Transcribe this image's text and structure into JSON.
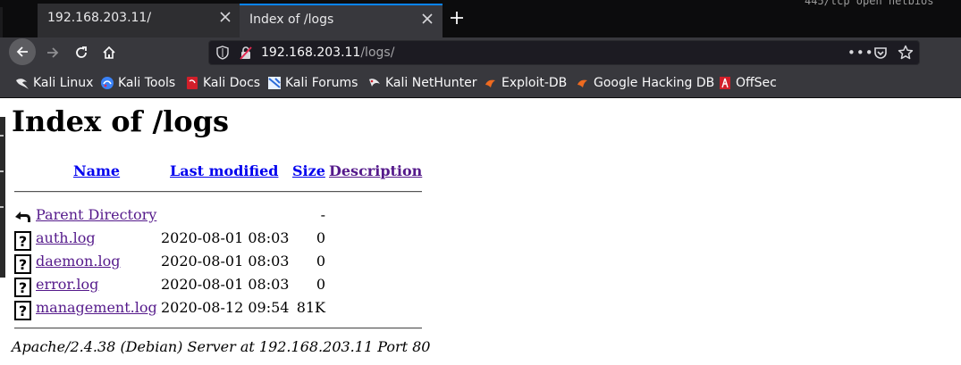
{
  "tabs": [
    {
      "title": "192.168.203.11/"
    },
    {
      "title": "Index of /logs"
    }
  ],
  "terminal_fragment": "445/tcp  open  netbios",
  "url": {
    "host": "192.168.203.11",
    "path": "/logs/"
  },
  "bookmarks": [
    {
      "label": "Kali Linux",
      "icon": "kali-dragon-icon"
    },
    {
      "label": "Kali Tools",
      "icon": "kali-tools-icon"
    },
    {
      "label": "Kali Docs",
      "icon": "kali-docs-icon"
    },
    {
      "label": "Kali Forums",
      "icon": "kali-forums-icon"
    },
    {
      "label": "Kali NetHunter",
      "icon": "nethunter-icon"
    },
    {
      "label": "Exploit-DB",
      "icon": "exploit-db-icon"
    },
    {
      "label": "Google Hacking DB",
      "icon": "ghdb-icon"
    },
    {
      "label": "OffSec",
      "icon": "offsec-icon"
    }
  ],
  "page": {
    "title": "Index of /logs",
    "columns": {
      "name": "Name",
      "last_modified": "Last modified",
      "size": "Size",
      "description": "Description"
    },
    "parent": {
      "name": "Parent Directory",
      "size": "-"
    },
    "files": [
      {
        "name": "auth.log",
        "modified": "2020-08-01 08:03",
        "size": "0"
      },
      {
        "name": "daemon.log",
        "modified": "2020-08-01 08:03",
        "size": "0"
      },
      {
        "name": "error.log",
        "modified": "2020-08-01 08:03",
        "size": "0"
      },
      {
        "name": "management.log",
        "modified": "2020-08-12 09:54",
        "size": "81K"
      }
    ],
    "address": "Apache/2.4.38 (Debian) Server at 192.168.203.11 Port 80"
  },
  "colors": {
    "accent": "#0a84ff",
    "link": "#0000ee",
    "visited": "#551a8b"
  }
}
